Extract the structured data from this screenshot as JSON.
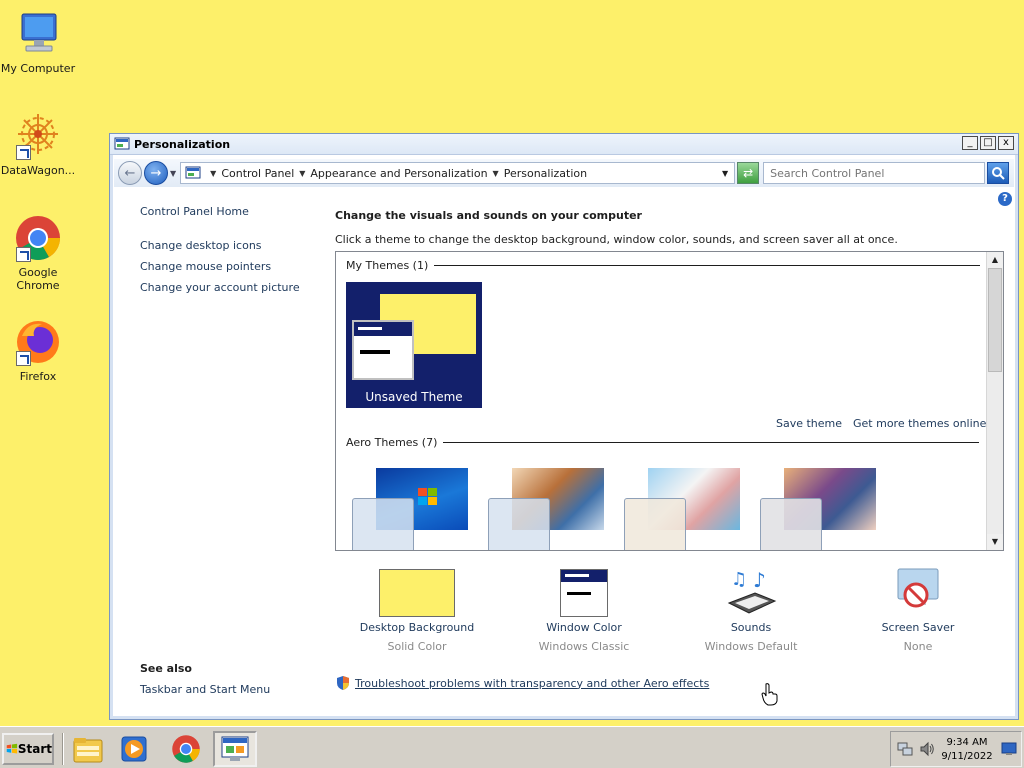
{
  "desktop": {
    "background_color": "#fdf06a",
    "icons": [
      {
        "label": "My Computer",
        "icon": "computer-icon"
      },
      {
        "label": "DataWagon...",
        "icon": "datawagon-icon"
      },
      {
        "label": "Google Chrome",
        "icon": "chrome-icon"
      },
      {
        "label": "Firefox",
        "icon": "firefox-icon"
      }
    ]
  },
  "window": {
    "title": "Personalization",
    "controls": {
      "minimize": "_",
      "maximize": "□",
      "close": "x"
    },
    "breadcrumb": [
      "Control Panel",
      "Appearance and Personalization",
      "Personalization"
    ],
    "search_placeholder": "Search Control Panel",
    "help_glyph": "?"
  },
  "sidebar": {
    "home": "Control Panel Home",
    "tasks": [
      "Change desktop icons",
      "Change mouse pointers",
      "Change your account picture"
    ],
    "see_also_heading": "See also",
    "see_also_links": [
      "Taskbar and Start Menu"
    ]
  },
  "main": {
    "title": "Change the visuals and sounds on your computer",
    "description": "Click a theme to change the desktop background, window color, sounds, and screen saver all at once.",
    "my_themes": {
      "header": "My Themes (1)",
      "tile_label": "Unsaved Theme",
      "save_link": "Save theme",
      "more_link": "Get more themes online"
    },
    "aero_themes": {
      "header": "Aero Themes (7)",
      "visible_thumbnails": [
        "windows-7-theme",
        "architecture-theme",
        "characters-theme",
        "landscapes-theme"
      ]
    },
    "settings": [
      {
        "label": "Desktop Background",
        "value": "Solid Color",
        "icon": "desktop-background-icon"
      },
      {
        "label": "Window Color",
        "value": "Windows Classic",
        "icon": "window-color-icon"
      },
      {
        "label": "Sounds",
        "value": "Windows Default",
        "icon": "sounds-icon"
      },
      {
        "label": "Screen Saver",
        "value": "None",
        "icon": "screen-saver-icon"
      }
    ],
    "troubleshoot_link": "Troubleshoot problems with transparency and other Aero effects"
  },
  "taskbar": {
    "start_label": "Start",
    "apps": [
      "file-explorer-icon",
      "media-player-icon",
      "chrome-icon",
      "control-panel-icon"
    ],
    "active_app": "control-panel-icon",
    "clock": {
      "time": "9:34 AM",
      "date": "9/11/2022"
    }
  },
  "colors": {
    "link": "#1e395b",
    "tile_background": "#13206b",
    "desktop_yellow": "#fdf06a",
    "muted_text": "#8a8a8a"
  }
}
